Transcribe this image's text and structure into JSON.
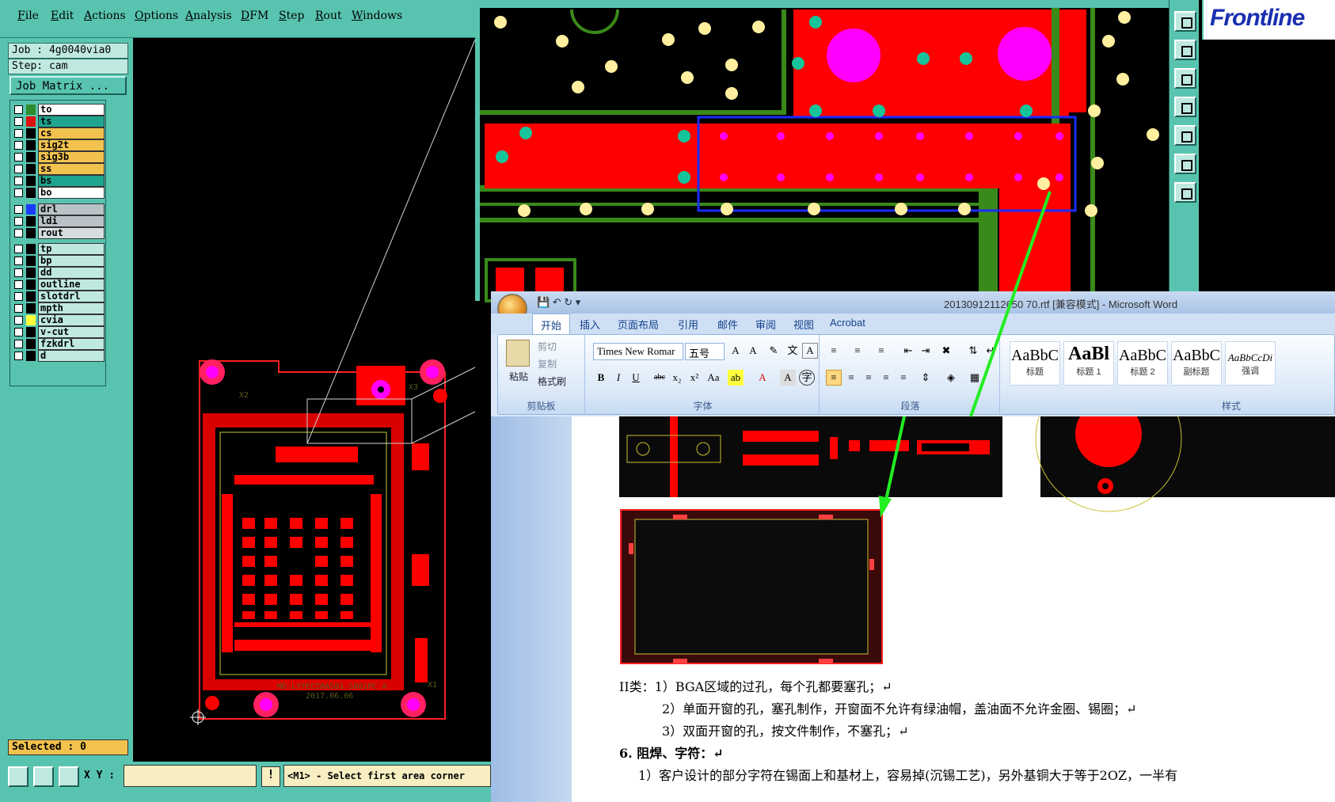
{
  "menubar": {
    "file": "File",
    "edit": "Edit",
    "actions": "Actions",
    "options": "Options",
    "analysis": "Analysis",
    "dfm": "DFM",
    "step": "Step",
    "rout": "Rout",
    "windows": "Windows"
  },
  "job": {
    "job_label": "Job : 4g0040via0",
    "step_label": "Step: cam",
    "matrix_button": "Job Matrix ..."
  },
  "layers": [
    {
      "name": "to",
      "color": "#2e8b2e",
      "bg": "#ffffff"
    },
    {
      "name": "ts",
      "color": "#e01010",
      "bg": "#1fa58f"
    },
    {
      "name": "cs",
      "color": "#000000",
      "bg": "#f2c24e"
    },
    {
      "name": "sig2t",
      "color": "#000000",
      "bg": "#f2c24e"
    },
    {
      "name": "sig3b",
      "color": "#000000",
      "bg": "#f2c24e"
    },
    {
      "name": "ss",
      "color": "#000000",
      "bg": "#f2c24e"
    },
    {
      "name": "bs",
      "color": "#000000",
      "bg": "#1fa58f"
    },
    {
      "name": "bo",
      "color": "#000000",
      "bg": "#ffffff"
    },
    {
      "name": "drl",
      "color": "#1a3cff",
      "bg": "#b9c3c7"
    },
    {
      "name": "ldi",
      "color": "#000000",
      "bg": "#b9c3c7"
    },
    {
      "name": "rout",
      "color": "#000000",
      "bg": "#d8dede"
    },
    {
      "name": "tp",
      "color": "#000000",
      "bg": "#bfe9e0"
    },
    {
      "name": "bp",
      "color": "#000000",
      "bg": "#bfe9e0"
    },
    {
      "name": "dd",
      "color": "#000000",
      "bg": "#bfe9e0"
    },
    {
      "name": "outline",
      "color": "#000000",
      "bg": "#bfe9e0"
    },
    {
      "name": "slotdrl",
      "color": "#000000",
      "bg": "#bfe9e0"
    },
    {
      "name": "mpth",
      "color": "#000000",
      "bg": "#bfe9e0"
    },
    {
      "name": "cvia",
      "color": "#ffff3a",
      "bg": "#bfe9e0"
    },
    {
      "name": "v-cut",
      "color": "#000000",
      "bg": "#bfe9e0"
    },
    {
      "name": "fzkdrl",
      "color": "#000000",
      "bg": "#bfe9e0"
    },
    {
      "name": "d",
      "color": "#000000",
      "bg": "#bfe9e0"
    }
  ],
  "status": {
    "selected": "Selected : 0",
    "xy_label": "X Y :",
    "warn": "!",
    "message": "<M1> - Select first area corner"
  },
  "brand": {
    "logo": "Frontline"
  },
  "board": {
    "silk_name": "MD-LYYEC20AS01-S001PC A",
    "silk_date": "2017.06.06",
    "ref_x2": "X2",
    "ref_x3": "X3",
    "ref_x1": "X1"
  },
  "word": {
    "title": "20130912112650 70.rtf [兼容模式] - Microsoft Word",
    "tabs": [
      "开始",
      "插入",
      "页面布局",
      "引用",
      "邮件",
      "审阅",
      "视图",
      "Acrobat"
    ],
    "clipboard": {
      "paste": "粘贴",
      "cut": "剪切",
      "copy": "复制",
      "format_painter": "格式刷",
      "group": "剪贴板"
    },
    "font": {
      "name": "Times New Romar",
      "size": "五号",
      "group": "字体"
    },
    "paragraph": {
      "group": "段落"
    },
    "styles": {
      "group": "样式",
      "items": [
        {
          "sample": "AaBbC",
          "label": "标题"
        },
        {
          "sample": "AaBl",
          "label": "标题 1"
        },
        {
          "sample": "AaBbC",
          "label": "标题 2"
        },
        {
          "sample": "AaBbC",
          "label": "副标题"
        },
        {
          "sample": "AaBbCcDi",
          "label": "强调"
        }
      ]
    },
    "body": {
      "line1": "II类：1）BGA区域的过孔，每个孔都要塞孔；↵",
      "line2": "2）单面开窗的孔，塞孔制作，开窗面不允许有绿油帽，盖油面不允许金圈、锡圈；↵",
      "line3": "3）双面开窗的孔，按文件制作，不塞孔；↵",
      "heading": "6.   阻焊、字符：↵",
      "line4": "1）客户设计的部分字符在锡面上和基材上，容易掉(沉锡工艺)，另外基铜大于等于2OZ，一半有"
    }
  },
  "colors": {
    "genesis_teal": "#58c4b0",
    "pad_red": "#ff0000",
    "trace_green": "#3a8a1a",
    "via_yellow": "#ffef9e",
    "arrow_green": "#22ee22"
  }
}
